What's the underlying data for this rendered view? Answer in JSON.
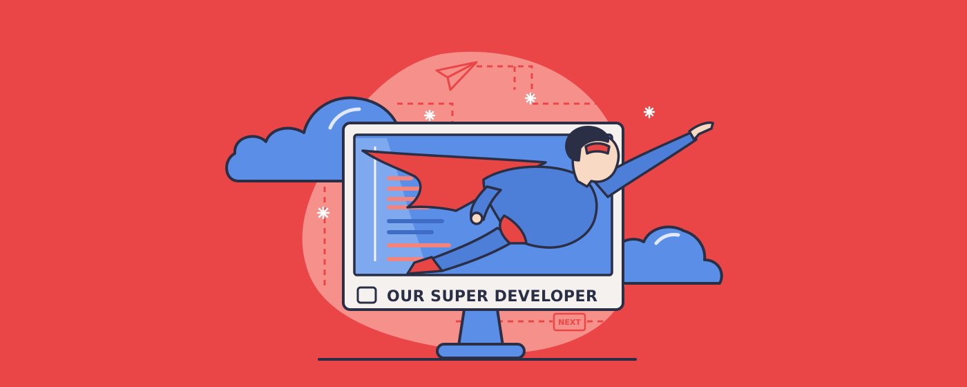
{
  "illustration": {
    "caption": "OUR SUPER DEVELOPER",
    "next_label": "NEXT",
    "colors": {
      "background": "#ea4648",
      "blob": "#f5908a",
      "cloud": "#5b8ee6",
      "monitor_frame": "#f4f1ee",
      "screen": "#5b8ee6",
      "outline": "#2a2f45",
      "cape": "#e84545",
      "suit": "#4e7fd8"
    }
  }
}
